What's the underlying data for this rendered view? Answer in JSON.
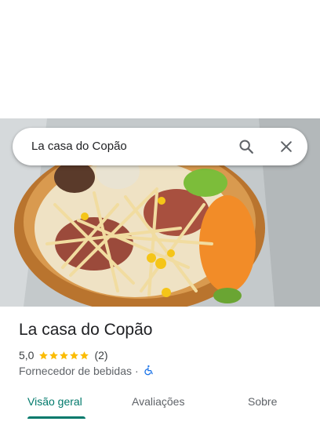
{
  "search": {
    "query": "La casa do Copão",
    "search_icon": "search-icon",
    "close_icon": "close-icon"
  },
  "hero_image": {
    "description_icon": "food-photo"
  },
  "place": {
    "name": "La casa do Copão",
    "rating": "5,0",
    "rating_stars": 5,
    "review_count": "(2)",
    "category": "Fornecedor de bebidas",
    "separator": "·",
    "accessibility_icon": "wheelchair-icon"
  },
  "tabs": [
    {
      "label": "Visão geral",
      "active": true
    },
    {
      "label": "Avaliações",
      "active": false
    },
    {
      "label": "Sobre",
      "active": false
    }
  ],
  "colors": {
    "accent": "#00796b",
    "star": "#fbbc04",
    "accessibility": "#1a73e8"
  }
}
